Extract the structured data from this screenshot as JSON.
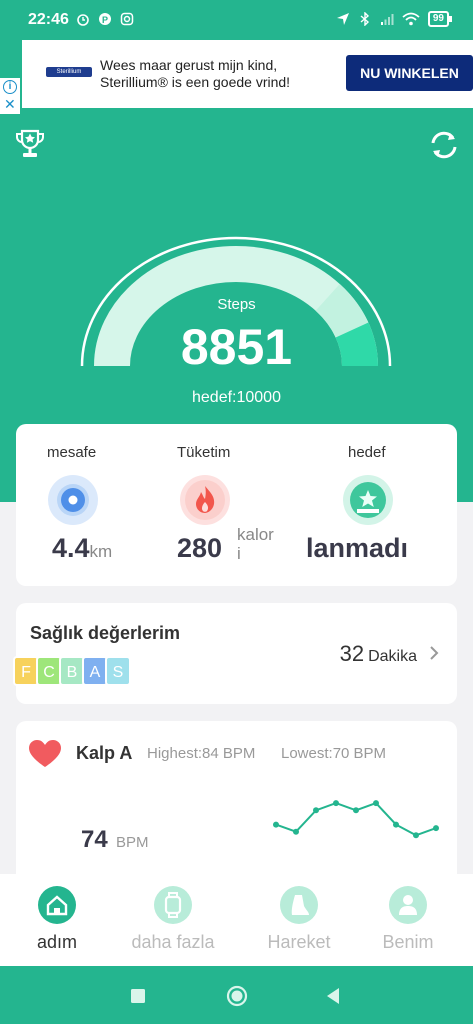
{
  "status_bar": {
    "time": "22:46",
    "battery": "99"
  },
  "ad": {
    "logo": "Sterillium",
    "text": "Wees maar gerust mijn kind, Sterillium® is een goede vrind!",
    "cta": "NU WINKELEN"
  },
  "steps": {
    "label": "Steps",
    "value": "8851",
    "goal": "hedef:10000",
    "progress": 0.8851
  },
  "stats": [
    {
      "label": "mesafe",
      "value": "4.4",
      "unit": "km"
    },
    {
      "label": "Tüketim",
      "value": "280",
      "unit": "kalor\ni"
    },
    {
      "label": "hedef",
      "value": "lanmadı",
      "unit": ""
    }
  ],
  "health": {
    "title": "Sağlık değerlerim",
    "grades": [
      "F",
      "C",
      "B",
      "A",
      "S"
    ],
    "minutes": "32",
    "minutes_unit": "Dakika"
  },
  "heart": {
    "title": "Kalp A",
    "highest": "Highest:84  BPM",
    "lowest": "Lowest:70  BPM",
    "bpm": "74",
    "bpm_unit": "BPM",
    "trend": [
      74,
      72,
      78,
      80,
      78,
      80,
      74,
      71,
      73
    ]
  },
  "nav": [
    {
      "label": "adım",
      "active": true
    },
    {
      "label": "daha fazla",
      "active": false
    },
    {
      "label": "Hareket",
      "active": false
    },
    {
      "label": "Benim",
      "active": false
    }
  ],
  "colors": {
    "brand": "#24b58f",
    "arc_track": "#d6f6ea",
    "arc_progress": "#c2f2e0"
  }
}
